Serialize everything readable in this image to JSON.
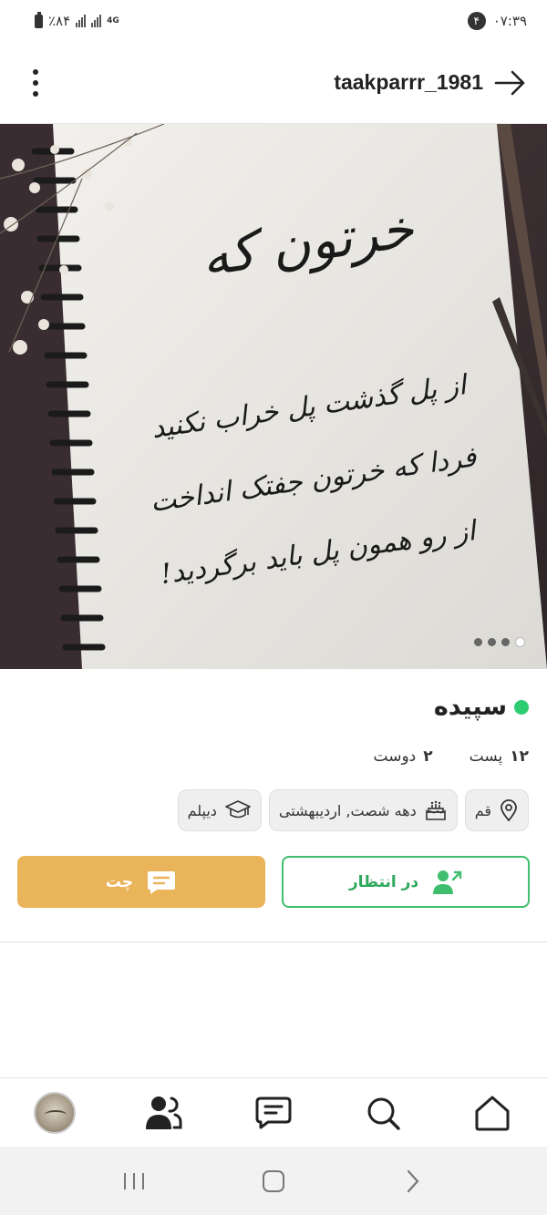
{
  "status_bar": {
    "battery": "٪۸۴",
    "network": "4G",
    "notification_count": "۴",
    "time": "۰۷:۳۹"
  },
  "header": {
    "username": "taakparrr_1981",
    "back_icon": "arrow-right-icon",
    "menu_icon": "more-vertical-icon"
  },
  "photo": {
    "image_count": 4,
    "active_index": 3,
    "lines": [
      "خرتون که",
      "از پل گذشت پل خراب نکنید",
      "فردا که خرتون جفتک انداخت",
      "از رو همون پل باید برگردید!"
    ]
  },
  "profile": {
    "name": "سپیده",
    "online": true,
    "online_color": "#2ecc71",
    "stats": [
      {
        "num": "۱۲",
        "label": "پست"
      },
      {
        "num": "۲",
        "label": "دوست"
      }
    ],
    "tags": [
      {
        "icon": "location-pin-icon",
        "label": "قم"
      },
      {
        "icon": "birthday-cake-icon",
        "label": "دهه شصت, اردیبهشتی"
      },
      {
        "icon": "graduation-cap-icon",
        "label": "دیپلم"
      }
    ]
  },
  "actions": {
    "pending_label": "در انتظار",
    "chat_label": "چت",
    "pending_color": "#3fbf6e",
    "chat_color": "#eab45a"
  },
  "bottom_nav": [
    "home-icon",
    "search-icon",
    "messages-icon",
    "friends-icon",
    "avatar"
  ]
}
